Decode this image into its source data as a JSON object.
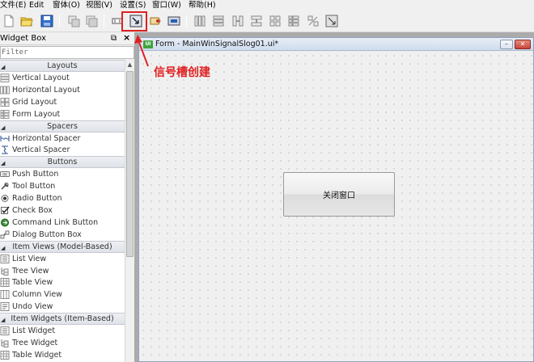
{
  "menubar": {
    "items": [
      "文件(E)",
      "Edit",
      "窗体(O)",
      "视图(V)",
      "设置(S)",
      "窗口(W)",
      "帮助(H)"
    ]
  },
  "toolbar": {
    "icons": [
      "new-file-icon",
      "open-folder-icon",
      "save-icon",
      "cut-icon",
      "copy-icon",
      "edit-widgets-icon",
      "edit-signals-slots-icon",
      "edit-buddies-icon",
      "edit-tab-order-icon",
      "layout-horizontal-icon",
      "layout-vertical-icon",
      "layout-horizontal-splitter-icon",
      "layout-vertical-splitter-icon",
      "layout-grid-icon",
      "layout-form-icon",
      "break-layout-icon",
      "adjust-size-icon"
    ],
    "highlight_color": "#e02020"
  },
  "widget_box": {
    "title": "Widget Box",
    "filter_placeholder": "Filter",
    "categories": [
      {
        "label": "Layouts",
        "items": [
          "Vertical Layout",
          "Horizontal Layout",
          "Grid Layout",
          "Form Layout"
        ]
      },
      {
        "label": "Spacers",
        "items": [
          "Horizontal Spacer",
          "Vertical Spacer"
        ]
      },
      {
        "label": "Buttons",
        "items": [
          "Push Button",
          "Tool Button",
          "Radio Button",
          "Check Box",
          "Command Link Button",
          "Dialog Button Box"
        ]
      },
      {
        "label": "Item Views (Model-Based)",
        "items": [
          "List View",
          "Tree View",
          "Table View",
          "Column View",
          "Undo View"
        ]
      },
      {
        "label": "Item Widgets (Item-Based)",
        "items": [
          "List Widget",
          "Tree Widget",
          "Table Widget"
        ]
      }
    ]
  },
  "form_window": {
    "title": "Form - MainWinSignalSlog01.ui*",
    "icon_text": "UI",
    "button_label": "关闭窗口"
  },
  "annotation": {
    "text": "信号槽创建",
    "color": "#e02020"
  }
}
